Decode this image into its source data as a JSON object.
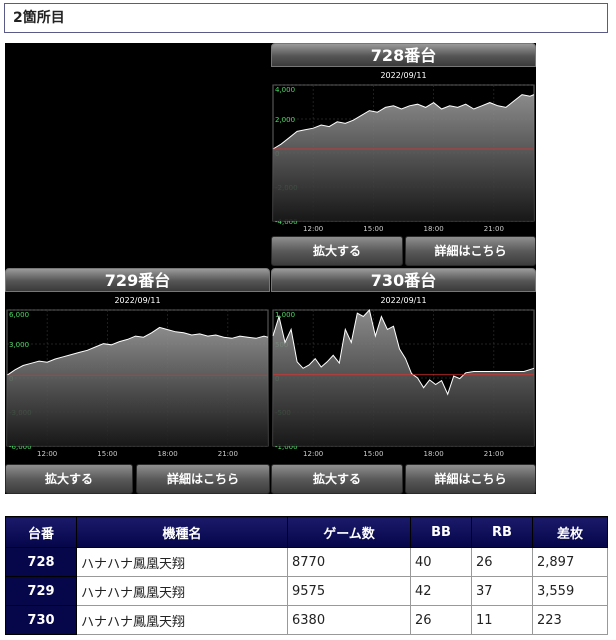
{
  "section": {
    "title": "2箇所目"
  },
  "charts": [
    {
      "machine_label": "728番台",
      "date": "2022/09/11",
      "zoom_label": "拡大する",
      "detail_label": "詳細はこちら",
      "chart_data": {
        "type": "line",
        "title": "2022/09/11",
        "yticks": [
          "4,000",
          "2,000",
          "0",
          "-2,000",
          "-4,000"
        ],
        "xticks": [
          "12:00",
          "15:00",
          "18:00",
          "21:00"
        ],
        "ylim": [
          -4500,
          4000
        ],
        "xlim": [
          10,
          23
        ],
        "zero_line": true,
        "series": [
          {
            "x": [
              10.0,
              10.4,
              10.8,
              11.2,
              11.6,
              12.0,
              12.4,
              12.8,
              13.2,
              13.6,
              14.0,
              14.4,
              14.8,
              15.2,
              15.6,
              16.0,
              16.4,
              16.8,
              17.2,
              17.6,
              18.0,
              18.4,
              18.8,
              19.2,
              19.6,
              20.0,
              20.4,
              20.8,
              21.2,
              21.6,
              22.0,
              22.4,
              22.8,
              23.0
            ],
            "values": [
              0,
              300,
              700,
              1100,
              1200,
              1300,
              1500,
              1400,
              1700,
              1600,
              1800,
              2100,
              2400,
              2300,
              2600,
              2700,
              2500,
              2700,
              2800,
              2600,
              2900,
              2500,
              2700,
              2600,
              2800,
              2500,
              2700,
              2900,
              2700,
              2600,
              3000,
              3400,
              3300,
              3400
            ]
          }
        ]
      }
    },
    {
      "machine_label": "729番台",
      "date": "2022/09/11",
      "zoom_label": "拡大する",
      "detail_label": "詳細はこちら",
      "chart_data": {
        "type": "line",
        "title": "2022/09/11",
        "yticks": [
          "6,000",
          "3,000",
          "0",
          "-3,000",
          "-6,000"
        ],
        "xticks": [
          "12:00",
          "15:00",
          "18:00",
          "21:00"
        ],
        "ylim": [
          -6500,
          6000
        ],
        "xlim": [
          10,
          23
        ],
        "zero_line": true,
        "series": [
          {
            "x": [
              10.0,
              10.4,
              10.8,
              11.2,
              11.6,
              12.0,
              12.4,
              12.8,
              13.2,
              13.6,
              14.0,
              14.4,
              14.8,
              15.2,
              15.6,
              16.0,
              16.4,
              16.8,
              17.2,
              17.6,
              18.0,
              18.4,
              18.8,
              19.2,
              19.6,
              20.0,
              20.4,
              20.8,
              21.2,
              21.6,
              22.0,
              22.4,
              22.8,
              23.0
            ],
            "values": [
              0,
              500,
              900,
              1100,
              1300,
              1200,
              1500,
              1700,
              1900,
              2100,
              2300,
              2600,
              2900,
              2800,
              3100,
              3300,
              3600,
              3500,
              3900,
              4400,
              4200,
              4000,
              3900,
              3700,
              3800,
              3600,
              3700,
              3500,
              3400,
              3600,
              3500,
              3400,
              3600,
              3500
            ]
          }
        ]
      }
    },
    {
      "machine_label": "730番台",
      "date": "2022/09/11",
      "zoom_label": "拡大する",
      "detail_label": "詳細はこちら",
      "chart_data": {
        "type": "line",
        "title": "2022/09/11",
        "yticks": [
          "1,000",
          "500",
          "0",
          "-500",
          "-1,000"
        ],
        "xticks": [
          "12:00",
          "15:00",
          "18:00",
          "21:00"
        ],
        "ylim": [
          -1100,
          1000
        ],
        "xlim": [
          10,
          23
        ],
        "zero_line": true,
        "series": [
          {
            "x": [
              10.0,
              10.3,
              10.6,
              10.9,
              11.2,
              11.5,
              11.8,
              12.1,
              12.4,
              12.7,
              13.0,
              13.3,
              13.6,
              13.9,
              14.2,
              14.5,
              14.8,
              15.1,
              15.4,
              15.7,
              16.0,
              16.3,
              16.6,
              16.9,
              17.2,
              17.5,
              17.8,
              18.1,
              18.4,
              18.7,
              19.0,
              19.3,
              19.6,
              20.0,
              20.5,
              21.0,
              21.5,
              22.0,
              22.5,
              23.0
            ],
            "values": [
              600,
              900,
              500,
              700,
              200,
              100,
              150,
              250,
              120,
              200,
              300,
              180,
              700,
              500,
              950,
              900,
              1000,
              600,
              900,
              700,
              750,
              400,
              250,
              20,
              -50,
              -200,
              -80,
              -150,
              -90,
              -300,
              -20,
              -60,
              30,
              50,
              50,
              50,
              50,
              50,
              50,
              100
            ]
          }
        ]
      }
    }
  ],
  "table": {
    "headers": [
      "台番",
      "機種名",
      "ゲーム数",
      "BB",
      "RB",
      "差枚"
    ],
    "rows": [
      [
        "728",
        "ハナハナ鳳凰天翔",
        "8770",
        "40",
        "26",
        "2,897"
      ],
      [
        "729",
        "ハナハナ鳳凰天翔",
        "9575",
        "42",
        "37",
        "3,559"
      ],
      [
        "730",
        "ハナハナ鳳凰天翔",
        "6380",
        "26",
        "11",
        "223"
      ]
    ]
  }
}
